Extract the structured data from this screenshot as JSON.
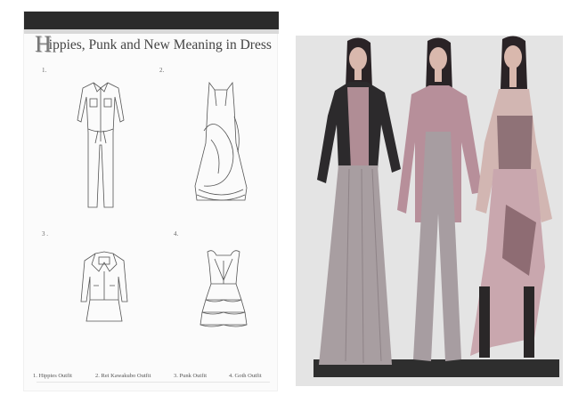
{
  "sheet": {
    "title_initial": "H",
    "title_rest": "ippies, Punk and New Meaning in Dress",
    "numbers": [
      "1.",
      "2.",
      "3 .",
      "4."
    ],
    "captions": [
      "1. Hippies Outfit",
      "2. Rei Kawakubo Outfit",
      "3. Punk Outfit",
      "4. Goth Outfit"
    ]
  },
  "colors": {
    "header_bar": "#2b2b2b",
    "sketch_line": "#555555",
    "mauve": "#b78f9a",
    "taupe": "#a99ea2",
    "dress_pink": "#c9a7ae"
  }
}
